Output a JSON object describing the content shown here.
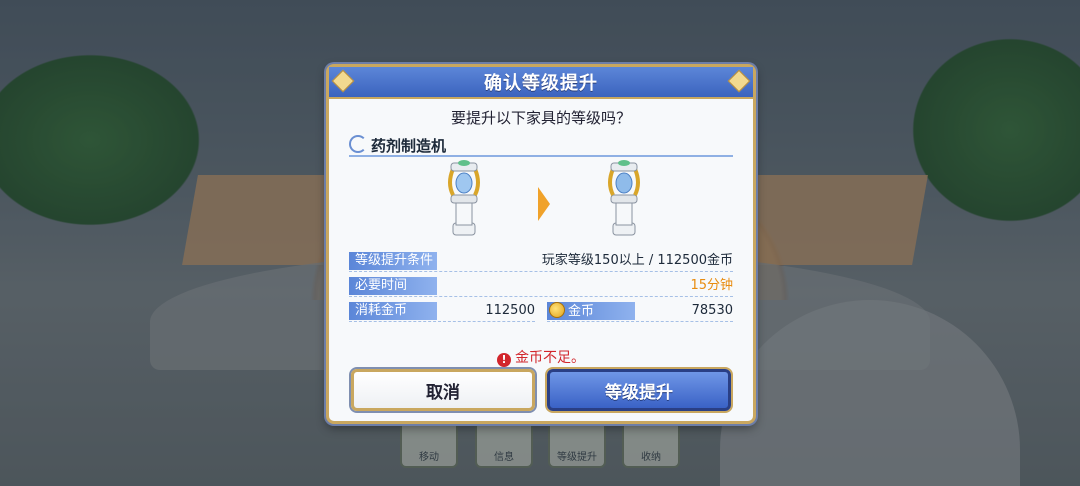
{
  "dialog": {
    "title": "确认等级提升",
    "question": "要提升以下家具的等级吗？",
    "item_name": "药剂制造机",
    "rows": {
      "condition_label": "等级提升条件",
      "condition_value": "玩家等级150以上 / 112500金币",
      "time_label": "必要时间",
      "time_value": "15分钟",
      "cost_label": "消耗金币",
      "cost_value": "112500",
      "gold_label": "金币",
      "gold_value": "78530"
    },
    "warning": "金币不足。",
    "cancel_label": "取消",
    "confirm_label": "等级提升"
  },
  "bottom_bar": {
    "move": "移动",
    "info": "信息",
    "level_up": "等级提升",
    "store": "收纳"
  },
  "colors": {
    "title_bar": "#3b63be",
    "accent_orange": "#f0a22a",
    "warning_red": "#d2262c",
    "gold_border": "#c9a75f"
  },
  "icons": [
    "swirl-icon",
    "potion-machine-icon",
    "arrow-right-icon",
    "gold-coin-icon",
    "exclamation-icon"
  ]
}
